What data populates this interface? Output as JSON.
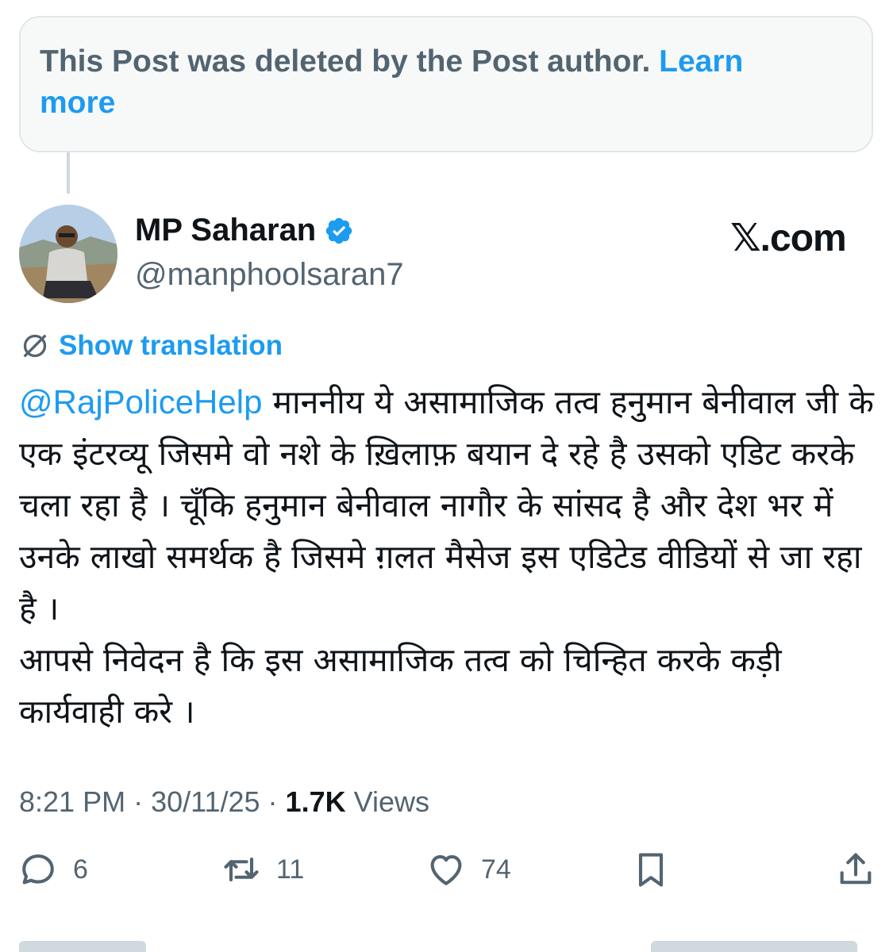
{
  "deleted_notice": {
    "text": "This Post was deleted by the Post author.",
    "link_line1": "Learn",
    "link_line2": "more"
  },
  "author": {
    "name": "MP Saharan",
    "handle": "@manphoolsaran7",
    "verified": true,
    "verified_color": "#1d9bf0",
    "avatar_icon": "profile-photo"
  },
  "brand": {
    "glyph": "𝕏",
    "suffix": ".com"
  },
  "translate": {
    "label": "Show translation",
    "icon": "globe-slash-icon"
  },
  "post": {
    "mention": "@RajPoliceHelp",
    "text": " माननीय ये असामाजिक तत्व हनुमान बेनीवाल जी के एक इंटरव्यू जिसमे वो नशे के ख़िलाफ़ बयान दे रहे है उसको एडिट करके चला रहा है । चूँकि हनुमान बेनीवाल नागौर के सांसद है और देश भर में उनके लाखो समर्थक है जिसमे ग़लत मैसेज इस एडिटेड वीडियों से जा रहा है ।\nआपसे निवेदन है कि इस असामाजिक तत्व को चिन्हित करके कड़ी कार्यवाही करे ।"
  },
  "meta": {
    "time": "8:21 PM",
    "sep1": " · ",
    "date": "30/11/25",
    "sep2": " · ",
    "views_count": "1.7K",
    "views_label": " Views"
  },
  "actions": {
    "replies": "6",
    "reposts": "11",
    "likes": "74"
  },
  "colors": {
    "accent": "#1d9bf0",
    "secondary_text": "#536471",
    "primary_text": "#0f1419"
  }
}
